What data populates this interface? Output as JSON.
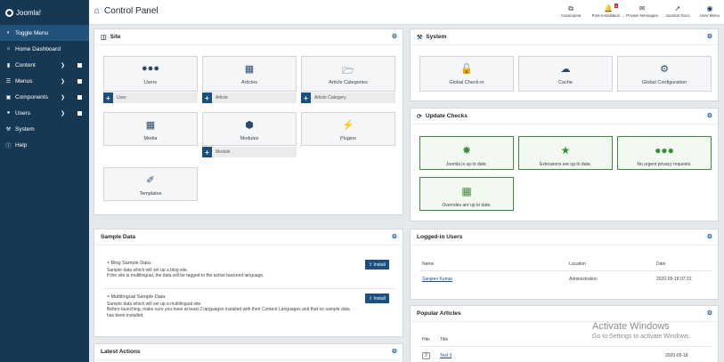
{
  "header": {
    "logo_text": "Joomla!",
    "title": "Control Panel",
    "tools": [
      {
        "label": "Cassiopeia",
        "icon": "external-link-icon"
      },
      {
        "label": "Post-installation ...",
        "icon": "bell-icon",
        "badge": "6"
      },
      {
        "label": "Private Messages",
        "icon": "envelope-icon"
      },
      {
        "label": "Joomla! Docs",
        "icon": "external-doc-icon"
      },
      {
        "label": "User Menu",
        "icon": "user-icon"
      }
    ]
  },
  "sidebar": {
    "items": [
      {
        "label": "Toggle Menu",
        "icon": "toggle-icon"
      },
      {
        "label": "Home Dashboard",
        "icon": "home-icon"
      },
      {
        "label": "Content",
        "icon": "file-icon"
      },
      {
        "label": "Menus",
        "icon": "list-icon"
      },
      {
        "label": "Components",
        "icon": "cube-icon"
      },
      {
        "label": "Users",
        "icon": "users-icon"
      },
      {
        "label": "System",
        "icon": "wrench-icon"
      },
      {
        "label": "Help",
        "icon": "info-icon"
      }
    ]
  },
  "site": {
    "title": "Site",
    "tiles": [
      {
        "label": "Users",
        "icon": "users-icon",
        "add": "User"
      },
      {
        "label": "Articles",
        "icon": "file-icon",
        "add": "Article"
      },
      {
        "label": "Article Categories",
        "icon": "folder-open-icon",
        "add": "Article Category"
      },
      {
        "label": "Media",
        "icon": "images-icon"
      },
      {
        "label": "Modules",
        "icon": "cube-icon",
        "add": "Module"
      },
      {
        "label": "Plugins",
        "icon": "plug-icon"
      },
      {
        "label": "Templates",
        "icon": "brush-icon"
      }
    ]
  },
  "system": {
    "title": "System",
    "tiles": [
      {
        "label": "Global Check-in",
        "icon": "unlock-icon"
      },
      {
        "label": "Cache",
        "icon": "cloud-icon"
      },
      {
        "label": "Global Configuration",
        "icon": "gear-icon"
      }
    ]
  },
  "update_checks": {
    "title": "Update Checks",
    "tiles": [
      {
        "label": "Joomla is up to date.",
        "icon": "joomla-icon"
      },
      {
        "label": "Extensions are up to date.",
        "icon": "star-icon"
      },
      {
        "label": "No urgent privacy requests.",
        "icon": "users-icon"
      },
      {
        "label": "Overrides are up to date.",
        "icon": "file-icon"
      }
    ]
  },
  "sample_data": {
    "title": "Sample Data",
    "items": [
      {
        "title": "Blog Sample Data",
        "lines": [
          "Sample data which will set up a blog site.",
          "If the site is multilingual, the data will be tagged to the active backend language."
        ],
        "button": "Install"
      },
      {
        "title": "Multilingual Sample Data",
        "lines": [
          "Sample data which will set up a multilingual site.",
          "Before launching, make sure you have at least 2 languages installed with their Content Languages and that no sample data has been installed."
        ],
        "button": "Install"
      }
    ]
  },
  "logged_in": {
    "title": "Logged-in Users",
    "columns": [
      "Name",
      "Location",
      "Date"
    ],
    "rows": [
      {
        "name": "Sanjeev Kumar",
        "location": "Administration",
        "date": "2020-05-18 07:22"
      }
    ]
  },
  "popular": {
    "title": "Popular Articles",
    "columns": [
      "Hits",
      "Title"
    ],
    "rows": [
      {
        "hits": "3",
        "title": "Test 3",
        "date": "2020-05-18"
      }
    ]
  },
  "latest_actions": {
    "title": "Latest Actions"
  },
  "watermark": {
    "line1": "Activate Windows",
    "line2": "Go to Settings to activate Windows."
  }
}
